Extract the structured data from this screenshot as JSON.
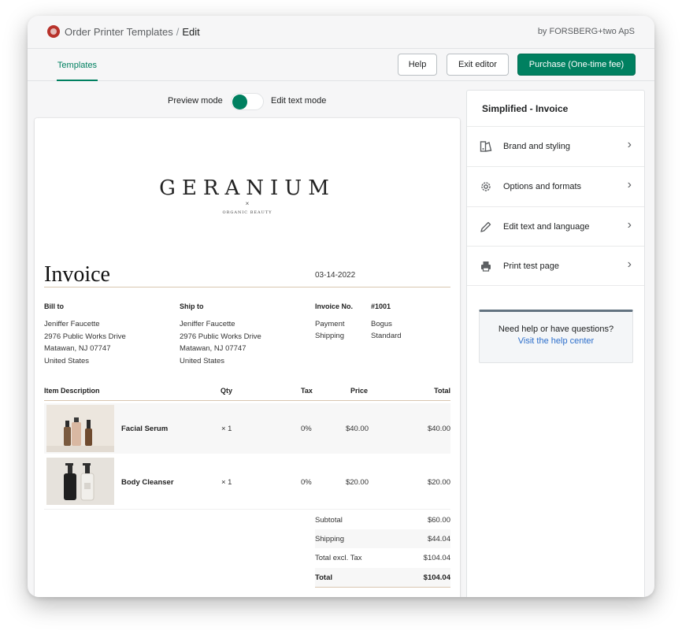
{
  "header": {
    "breadcrumb_app": "Order Printer Templates",
    "breadcrumb_sep": "/",
    "breadcrumb_current": "Edit",
    "vendor": "by FORSBERG+two ApS"
  },
  "tabs": [
    {
      "label": "Templates",
      "active": true
    }
  ],
  "buttons": {
    "help": "Help",
    "exit": "Exit editor",
    "purchase": "Purchase (One-time fee)"
  },
  "mode": {
    "left_label": "Preview mode",
    "right_label": "Edit text mode",
    "toggle_state": "preview"
  },
  "invoice": {
    "brand": "GERANIUM",
    "brand_x": "×",
    "brand_sub": "ORGANIC BEAUTY",
    "title": "Invoice",
    "date": "03-14-2022",
    "bill_to": {
      "label": "Bill to",
      "lines": [
        "Jeniffer Faucette",
        "2976 Public Works Drive",
        "Matawan, NJ 07747",
        "United States"
      ]
    },
    "ship_to": {
      "label": "Ship to",
      "lines": [
        "Jeniffer Faucette",
        "2976 Public Works Drive",
        "Matawan, NJ 07747",
        "United States"
      ]
    },
    "invoice_no_label": "Invoice No.",
    "invoice_no": "#1001",
    "payment_label": "Payment",
    "payment_value": "Bogus",
    "shipping_label": "Shipping",
    "shipping_value": "Standard",
    "columns": [
      "Item Description",
      "Qty",
      "Tax",
      "Price",
      "Total"
    ],
    "items": [
      {
        "name": "Facial Serum",
        "qty": "× 1",
        "tax": "0%",
        "price": "$40.00",
        "total": "$40.00",
        "image": "serum-bottles-image"
      },
      {
        "name": "Body Cleanser",
        "qty": "× 1",
        "tax": "0%",
        "price": "$20.00",
        "total": "$20.00",
        "image": "cleanser-bottles-image"
      }
    ],
    "summary": [
      {
        "label": "Subtotal",
        "value": "$60.00"
      },
      {
        "label": "Shipping",
        "value": "$44.04"
      },
      {
        "label": "Total excl. Tax",
        "value": "$104.04"
      },
      {
        "label": "Total",
        "value": "$104.04"
      }
    ]
  },
  "panel": {
    "title": "Simplified - Invoice",
    "items": [
      {
        "label": "Brand and styling",
        "icon": "brand-styling-icon"
      },
      {
        "label": "Options and formats",
        "icon": "gear-icon"
      },
      {
        "label": "Edit text and language",
        "icon": "pencil-icon"
      },
      {
        "label": "Print test page",
        "icon": "printer-icon"
      }
    ],
    "help_question": "Need help or have questions?",
    "help_link": "Visit the help center"
  },
  "colors": {
    "accent": "#008060",
    "link": "#2c6ecb",
    "invoice_rule": "#d8c6b0"
  }
}
